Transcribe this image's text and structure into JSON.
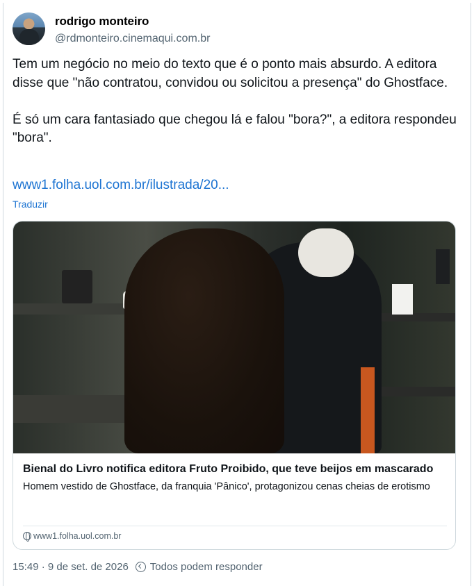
{
  "author": {
    "display_name": "rodrigo monteiro",
    "handle": "@rdmonteiro.cinemaqui.com.br"
  },
  "post": {
    "text": "Tem um negócio no meio do texto que é o ponto mais absurdo. A editora disse que \"não contratou, convidou ou solicitou a presença\" do Ghostface.\n\nÉ só um cara fantasiado que chegou lá e falou \"bora?\", a editora respondeu \"bora\".",
    "link_text": "www1.folha.uol.com.br/ilustrada/20...",
    "translate_label": "Traduzir"
  },
  "card": {
    "title": "Bienal do Livro notifica editora Fruto Proibido, que teve beijos em mascarado",
    "description": "Homem vestido de Ghostface, da franquia 'Pânico', protagonizou cenas cheias de erotismo",
    "source": "www1.folha.uol.com.br",
    "source_icon": "globe-icon"
  },
  "footer": {
    "timestamp": "15:49 · 9 de set. de 2026",
    "reply_setting": "Todos podem responder",
    "reply_icon": "reply-permission-icon"
  },
  "colors": {
    "link": "#1d74d2",
    "secondary_text": "#536471",
    "border": "#cfd9de"
  }
}
